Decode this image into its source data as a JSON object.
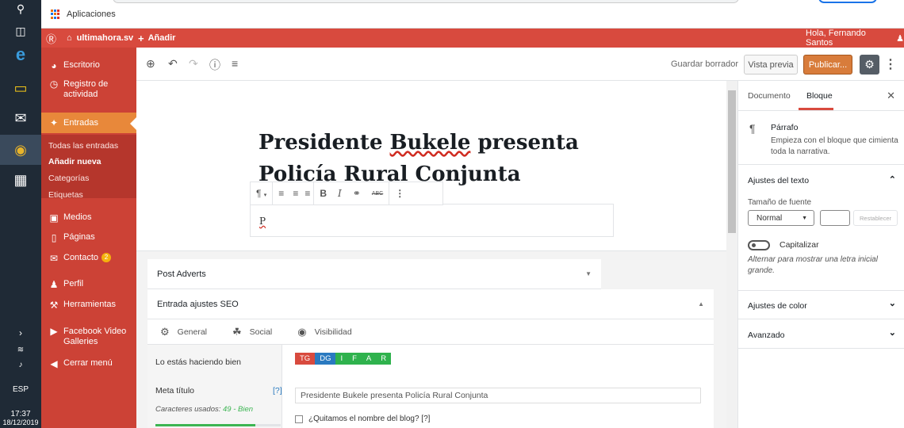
{
  "taskbar": {
    "time": "17:37",
    "date": "18/12/2019",
    "lang": "ESP"
  },
  "bookmarks": {
    "apps_label": "Aplicaciones"
  },
  "adminbar": {
    "site_name": "ultimahora.sv",
    "add_new": "Añadir",
    "greeting": "Hola, Fernando Santos"
  },
  "menu": {
    "escritorio": "Escritorio",
    "registro": "Registro de actividad",
    "entradas": "Entradas",
    "sub_todas": "Todas las entradas",
    "sub_anadir": "Añadir nueva",
    "sub_categorias": "Categorías",
    "sub_etiquetas": "Etiquetas",
    "medios": "Medios",
    "paginas": "Páginas",
    "contacto": "Contacto",
    "contacto_badge": "2",
    "perfil": "Perfil",
    "herramientas": "Herramientas",
    "facebook": "Facebook Video Galleries",
    "cerrar": "Cerrar menú"
  },
  "editor_header": {
    "save_draft": "Guardar borrador",
    "preview": "Vista previa",
    "publish": "Publicar..."
  },
  "post": {
    "title_line1_a": "Presidente ",
    "title_line1_b": "Bukele",
    "title_line1_c": " presenta",
    "title_line2": "Policía Rural Conjunta",
    "paragraph": "P"
  },
  "metaboxes": {
    "post_adverts": "Post Adverts",
    "seo_title": "Entrada ajustes SEO",
    "tabs": [
      "General",
      "Social",
      "Visibilidad"
    ],
    "row1_label": "Lo estás haciendo bien",
    "score_labels": [
      "TG",
      "DG",
      "I",
      "F",
      "A",
      "R"
    ],
    "score_colors": [
      "#d84a3e",
      "#2a7ac0",
      "#2fb24d",
      "#2fb24d",
      "#2fb24d",
      "#2fb24d"
    ],
    "meta_title_label": "Meta título",
    "meta_title_help": "[?]",
    "chars_used_prefix": "Caracteres usados: ",
    "chars_used_value": "49 - Bien",
    "meta_title_value": "Presidente Bukele presenta Policía Rural Conjunta",
    "remove_blog_name": "¿Quitamos el nombre del blog? [?]",
    "progress": 0.8
  },
  "sidebar": {
    "tab_document": "Documento",
    "tab_block": "Bloque",
    "block_name": "Párrafo",
    "block_desc": "Empieza con el bloque que cimienta toda la narrativa.",
    "text_settings": "Ajustes del texto",
    "font_size_label": "Tamaño de fuente",
    "font_size_value": "Normal",
    "reset": "Restablecer",
    "drop_cap": "Capitalizar",
    "drop_cap_help": "Alternar para mostrar una letra inicial grande.",
    "color_settings": "Ajustes de color",
    "advanced": "Avanzado"
  }
}
